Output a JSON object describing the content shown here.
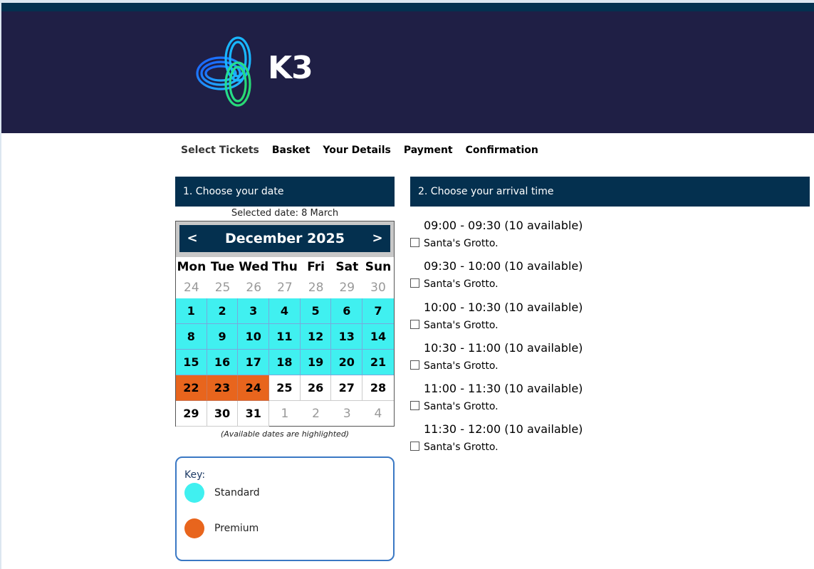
{
  "brand": {
    "name": "K3",
    "accent": "#04304f",
    "header_bg": "#1f1f45"
  },
  "nav": {
    "steps": [
      "Select Tickets",
      "Basket",
      "Your Details",
      "Payment",
      "Confirmation"
    ]
  },
  "date_panel": {
    "title": "1. Choose your date",
    "selected_date": "Selected date: 8 March",
    "note": "(Available dates are highlighted)"
  },
  "calendar": {
    "month_label": "December 2025",
    "prev_label": "<",
    "next_label": ">",
    "weekdays": [
      "Mon",
      "Tue",
      "Wed",
      "Thu",
      "Fri",
      "Sat",
      "Sun"
    ],
    "weeks": [
      [
        {
          "d": "24",
          "t": "other"
        },
        {
          "d": "25",
          "t": "other"
        },
        {
          "d": "26",
          "t": "other"
        },
        {
          "d": "27",
          "t": "other"
        },
        {
          "d": "28",
          "t": "other"
        },
        {
          "d": "29",
          "t": "other"
        },
        {
          "d": "30",
          "t": "other"
        }
      ],
      [
        {
          "d": "1",
          "t": "std"
        },
        {
          "d": "2",
          "t": "std"
        },
        {
          "d": "3",
          "t": "std"
        },
        {
          "d": "4",
          "t": "std"
        },
        {
          "d": "5",
          "t": "std"
        },
        {
          "d": "6",
          "t": "std"
        },
        {
          "d": "7",
          "t": "std"
        }
      ],
      [
        {
          "d": "8",
          "t": "std"
        },
        {
          "d": "9",
          "t": "std"
        },
        {
          "d": "10",
          "t": "std"
        },
        {
          "d": "11",
          "t": "std"
        },
        {
          "d": "12",
          "t": "std"
        },
        {
          "d": "13",
          "t": "std"
        },
        {
          "d": "14",
          "t": "std"
        }
      ],
      [
        {
          "d": "15",
          "t": "std"
        },
        {
          "d": "16",
          "t": "std"
        },
        {
          "d": "17",
          "t": "std"
        },
        {
          "d": "18",
          "t": "std"
        },
        {
          "d": "19",
          "t": "std"
        },
        {
          "d": "20",
          "t": "std"
        },
        {
          "d": "21",
          "t": "std"
        }
      ],
      [
        {
          "d": "22",
          "t": "prem"
        },
        {
          "d": "23",
          "t": "prem"
        },
        {
          "d": "24",
          "t": "prem"
        },
        {
          "d": "25",
          "t": "plain"
        },
        {
          "d": "26",
          "t": "plain"
        },
        {
          "d": "27",
          "t": "plain"
        },
        {
          "d": "28",
          "t": "plain"
        }
      ],
      [
        {
          "d": "29",
          "t": "plain"
        },
        {
          "d": "30",
          "t": "plain"
        },
        {
          "d": "31",
          "t": "plain"
        },
        {
          "d": "1",
          "t": "other"
        },
        {
          "d": "2",
          "t": "other"
        },
        {
          "d": "3",
          "t": "other"
        },
        {
          "d": "4",
          "t": "other"
        }
      ]
    ]
  },
  "key": {
    "title": "Key:",
    "items": [
      {
        "label": "Standard",
        "color": "#40f0f0"
      },
      {
        "label": "Premium",
        "color": "#e8651d"
      }
    ]
  },
  "time_panel": {
    "title": "2. Choose your arrival time",
    "slots": [
      {
        "time": "09:00 - 09:30 (10 available)",
        "label": "Santa's Grotto."
      },
      {
        "time": "09:30 - 10:00 (10 available)",
        "label": "Santa's Grotto."
      },
      {
        "time": "10:00 - 10:30 (10 available)",
        "label": "Santa's Grotto."
      },
      {
        "time": "10:30 - 11:00 (10 available)",
        "label": "Santa's Grotto."
      },
      {
        "time": "11:00 - 11:30 (10 available)",
        "label": "Santa's Grotto."
      },
      {
        "time": "11:30 - 12:00 (10 available)",
        "label": "Santa's Grotto."
      }
    ]
  }
}
